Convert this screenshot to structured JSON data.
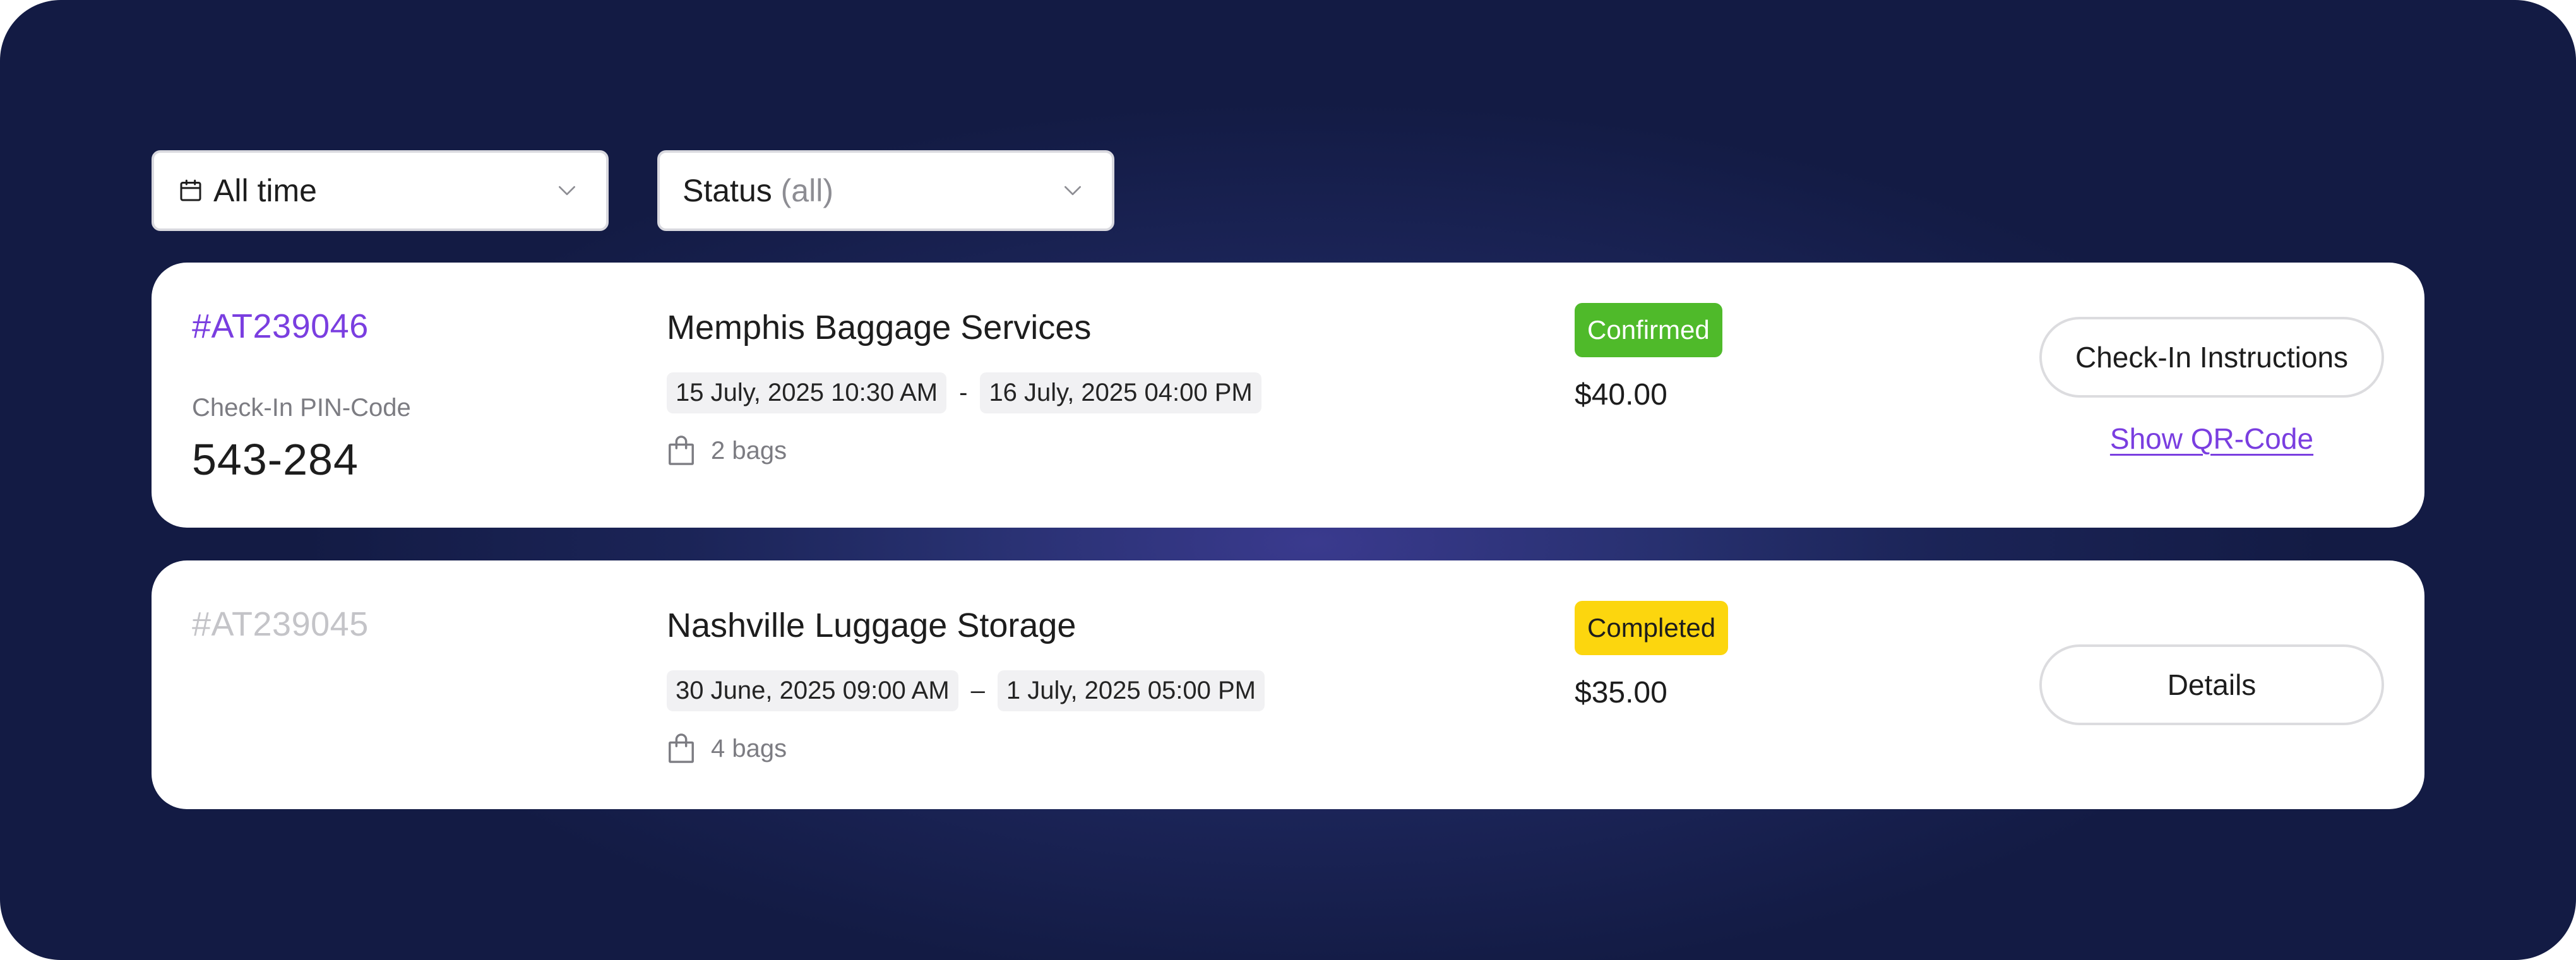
{
  "filters": {
    "date": {
      "label": "All time",
      "icon": "calendar-icon"
    },
    "status": {
      "label": "Status",
      "value": "(all)"
    }
  },
  "bookings": [
    {
      "id": "#AT239046",
      "pin_label": "Check-In PIN-Code",
      "pin": "543-284",
      "venue": "Memphis Baggage Services",
      "start": "15 July, 2025 10:30 AM",
      "separator": "-",
      "end": "16 July, 2025 04:00 PM",
      "bags": "2 bags",
      "status": "Confirmed",
      "status_color": "#4fba2a",
      "price": "$40.00",
      "primary_action": "Check-In Instructions",
      "secondary_action": "Show QR-Code"
    },
    {
      "id": "#AT239045",
      "venue": "Nashville Luggage Storage",
      "start": "30 June, 2025 09:00 AM",
      "separator": "–",
      "end": "1 July, 2025 05:00 PM",
      "bags": "4 bags",
      "status": "Completed",
      "status_color": "#fcd60e",
      "price": "$35.00",
      "primary_action": "Details"
    }
  ],
  "colors": {
    "accent": "#7a3ee0",
    "background": "#1b2457"
  }
}
